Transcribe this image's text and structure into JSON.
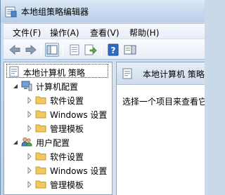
{
  "window": {
    "title": "本地组策略编辑器"
  },
  "menu": {
    "file": "文件(F)",
    "action": "操作(A)",
    "view": "查看(V)",
    "help": "帮助(H)"
  },
  "toolbar": {
    "buttons": [
      "back-arrow-icon",
      "forward-arrow-icon",
      "show-hide-tree-icon",
      "properties-icon",
      "export-list-icon",
      "help-icon",
      "show-hide-action-pane-icon"
    ]
  },
  "tree": {
    "root": "本地计算机 策略",
    "computer": {
      "label": "计算机配置",
      "children": [
        "软件设置",
        "Windows 设置",
        "管理模板"
      ]
    },
    "user": {
      "label": "用户配置",
      "children": [
        "软件设置",
        "Windows 设置",
        "管理模板"
      ]
    }
  },
  "details": {
    "header": "本地计算机 策略",
    "message": "选择一个项目来查看它的描述。"
  },
  "colors": {
    "folder": "#f2c75c",
    "selection_border": "#3a3a3a",
    "titlebar": "#c6d9ee"
  }
}
